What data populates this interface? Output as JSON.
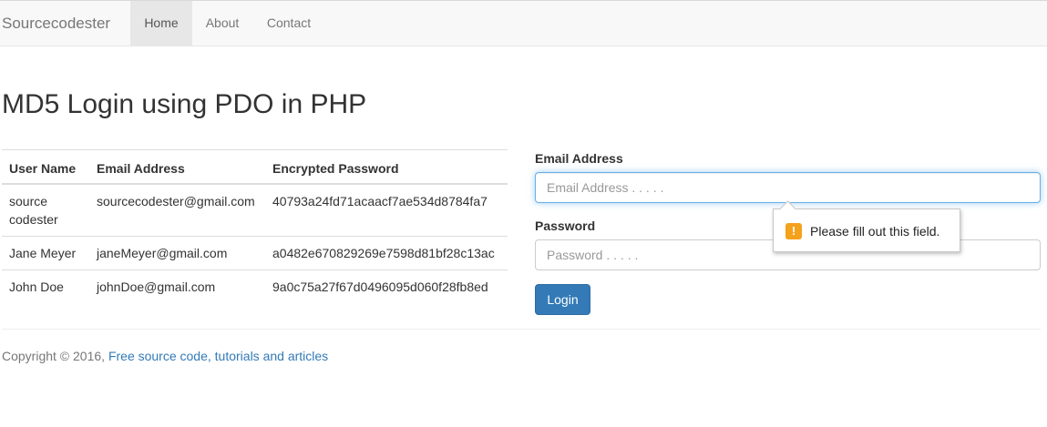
{
  "navbar": {
    "brand": "Sourcecodester",
    "items": [
      {
        "label": "Home",
        "active": true
      },
      {
        "label": "About",
        "active": false
      },
      {
        "label": "Contact",
        "active": false
      }
    ]
  },
  "page": {
    "title": "MD5 Login using PDO in PHP"
  },
  "table": {
    "headers": [
      "User Name",
      "Email Address",
      "Encrypted Password"
    ],
    "rows": [
      [
        "source codester",
        "sourcecodester@gmail.com",
        "40793a24fd71acaacf7ae534d8784fa7"
      ],
      [
        "Jane Meyer",
        "janeMeyer@gmail.com",
        "a0482e670829269e7598d81bf28c13ac"
      ],
      [
        "John Doe",
        "johnDoe@gmail.com",
        "9a0c75a27f67d0496095d060f28fb8ed"
      ]
    ]
  },
  "form": {
    "email_label": "Email Address",
    "email_placeholder": "Email Address . . . . .",
    "email_value": "",
    "password_label": "Password",
    "password_placeholder": "Password . . . . .",
    "password_value": "",
    "login_label": "Login",
    "validation_message": "Please fill out this field.",
    "warning_glyph": "!"
  },
  "footer": {
    "text": "Copyright © 2016, ",
    "link_text": "Free source code, tutorials and articles"
  },
  "colors": {
    "primary": "#337ab7",
    "navbar_bg": "#f8f8f8",
    "active_nav_bg": "#e7e7e7",
    "focus_border": "#66afe9",
    "warning": "#f4a11c"
  }
}
